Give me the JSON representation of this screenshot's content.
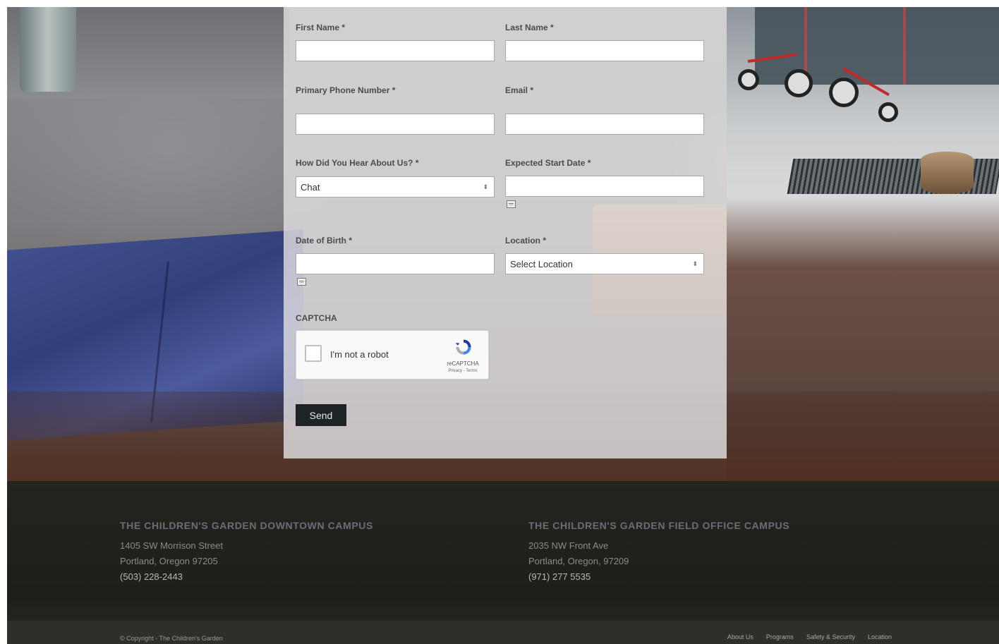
{
  "form": {
    "first_name_label": "First Name *",
    "last_name_label": "Last Name *",
    "phone_label": "Primary Phone Number *",
    "email_label": "Email *",
    "hear_label": "How Did You Hear About Us? *",
    "hear_value": "Chat",
    "start_date_label": "Expected Start Date *",
    "dob_label": "Date of Birth *",
    "location_label": "Location *",
    "location_value": "Select Location",
    "captcha_label": "CAPTCHA",
    "send_label": "Send"
  },
  "recaptcha": {
    "text": "I'm not a robot",
    "brand": "reCAPTCHA",
    "links": "Privacy - Terms"
  },
  "footer": {
    "downtown": {
      "title": "THE CHILDREN'S GARDEN DOWNTOWN CAMPUS",
      "street": "1405 SW Morrison Street",
      "city": "Portland, Oregon 97205",
      "phone": "(503) 228-2443"
    },
    "field_office": {
      "title": "THE CHILDREN'S GARDEN FIELD OFFICE CAMPUS",
      "street": "2035 NW Front Ave",
      "city": "Portland, Oregon, 97209",
      "phone": "(971) 277 5535"
    },
    "copyright": "© Copyright - The Children's Garden",
    "nav": [
      "About Us",
      "Programs",
      "Safety & Security",
      "Location"
    ]
  },
  "colors": {
    "button_bg": "#1e2326",
    "footer_bg": "#25241f",
    "footer_title": "#6a6d78"
  }
}
